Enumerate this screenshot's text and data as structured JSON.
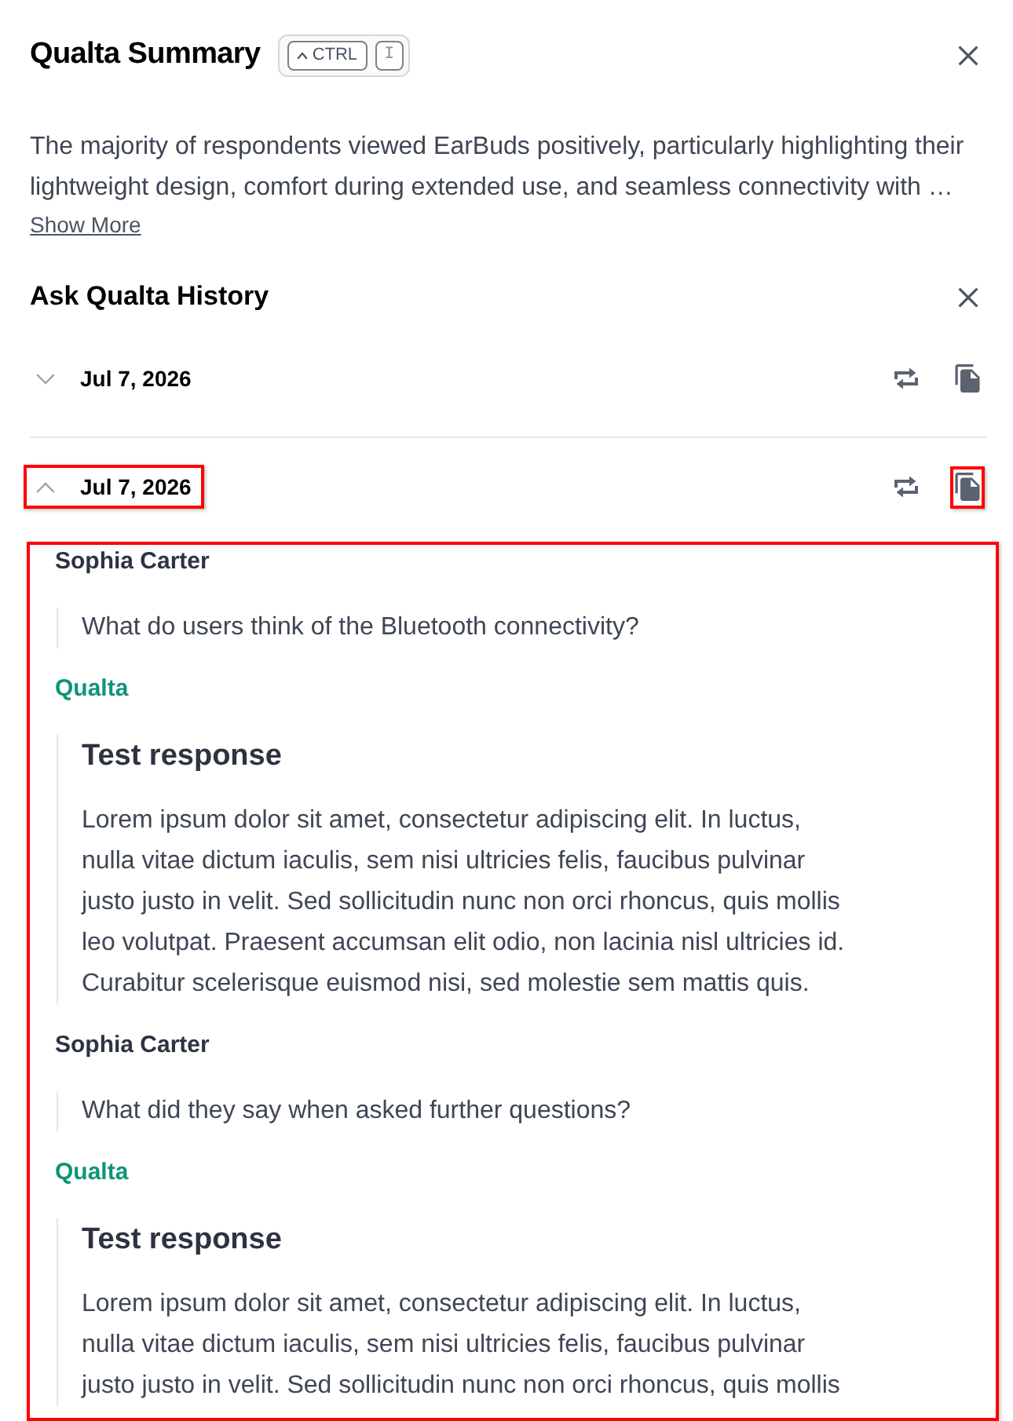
{
  "summary": {
    "title": "Qualta Summary",
    "shortcut": [
      {
        "kind": "modifier",
        "label": "CTRL"
      },
      {
        "kind": "plain",
        "label": "I"
      }
    ],
    "text": "The majority of respondents viewed EarBuds positively, particularly highlighting their lightweight design, comfort during extended use, and seamless connectivity with …",
    "show_more": "Show More"
  },
  "history": {
    "title": "Ask Qualta History",
    "entries": [
      {
        "date": "Jul 7, 2026",
        "expanded": false,
        "header_highlighted": false,
        "copy_highlighted": false
      },
      {
        "date": "Jul 7, 2026",
        "expanded": true,
        "header_highlighted": true,
        "copy_highlighted": true,
        "panel_highlighted": true,
        "messages": [
          {
            "kind": "user",
            "author": "Sophia Carter",
            "text": "What do users think of the Bluetooth connectivity?"
          },
          {
            "kind": "assistant",
            "author": "Qualta",
            "heading": "Test response",
            "text": "Lorem ipsum dolor sit amet, consectetur adipiscing elit. In luctus, nulla vitae dictum iaculis, sem nisi ultricies felis, faucibus pulvinar justo justo in velit. Sed sollicitudin nunc non orci rhoncus, quis mollis leo volutpat. Praesent accumsan elit odio, non lacinia nisl ultricies id. Curabitur scelerisque euismod nisi, sed molestie sem mattis quis."
          },
          {
            "kind": "user",
            "author": "Sophia Carter",
            "text": "What did they say when asked further questions?"
          },
          {
            "kind": "assistant",
            "author": "Qualta",
            "heading": "Test response",
            "text": "Lorem ipsum dolor sit amet, consectetur adipiscing elit. In luctus, nulla vitae dictum iaculis, sem nisi ultricies felis, faucibus pulvinar justo justo in velit. Sed sollicitudin nunc non orci rhoncus, quis mollis"
          }
        ]
      }
    ]
  }
}
